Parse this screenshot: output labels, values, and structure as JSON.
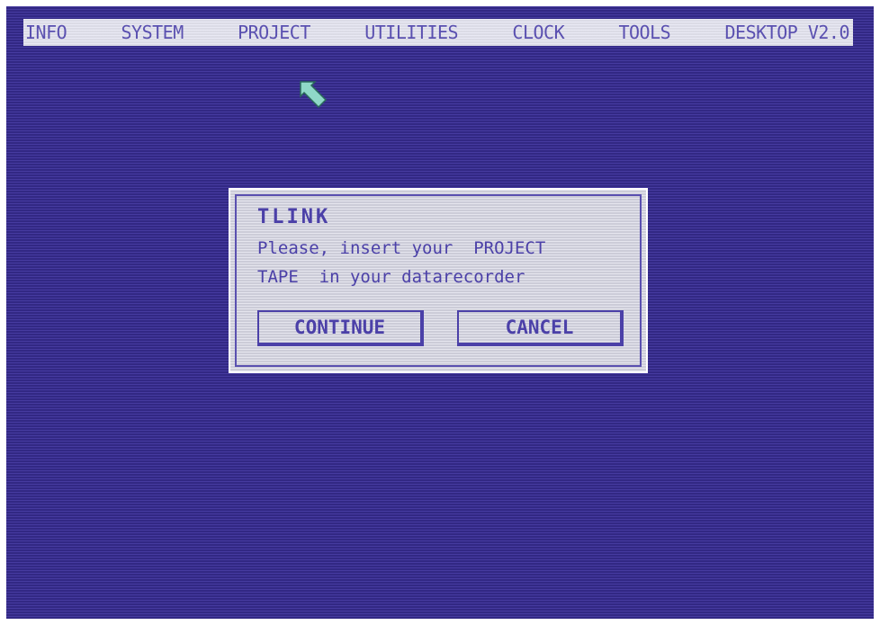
{
  "menubar": {
    "items": [
      {
        "label": "INFO"
      },
      {
        "label": "SYSTEM"
      },
      {
        "label": "PROJECT"
      },
      {
        "label": "UTILITIES"
      },
      {
        "label": "CLOCK"
      },
      {
        "label": "TOOLS"
      },
      {
        "label": "DESKTOP V2.0"
      }
    ]
  },
  "cursor": {
    "icon": "arrow-pointer-icon",
    "color": "#8fd8c8"
  },
  "dialog": {
    "title": "TLINK",
    "line1": "Please, insert your  PROJECT",
    "line2": "TAPE  in your datarecorder",
    "continue_label": "CONTINUE",
    "cancel_label": "CANCEL"
  },
  "colors": {
    "background": "#3a2f9a",
    "menubar": "#e9e9f4",
    "text": "#4b40a8",
    "dialog": "#dcdce8"
  }
}
